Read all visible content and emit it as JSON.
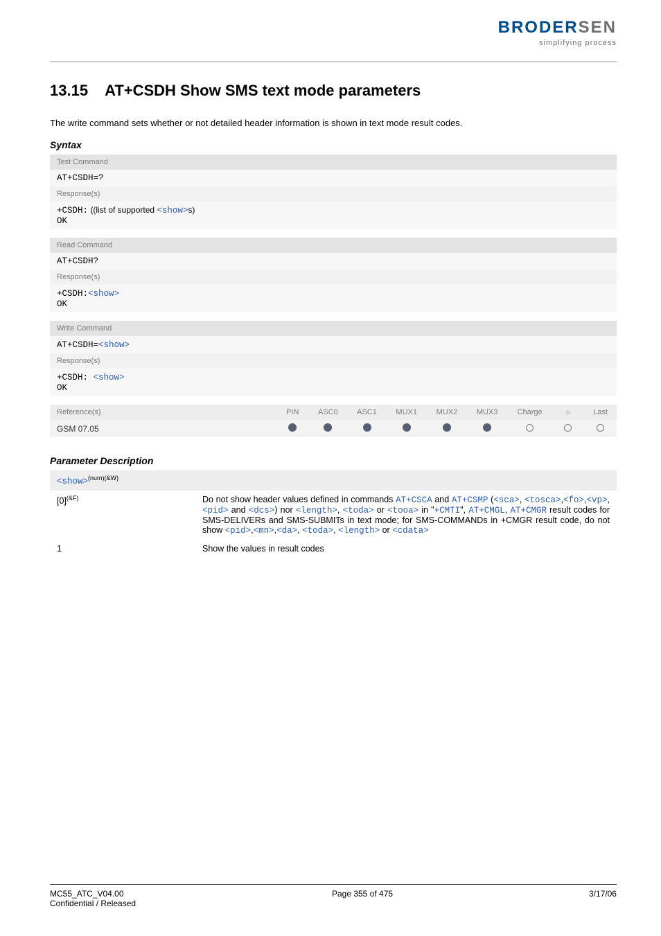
{
  "logo": {
    "brand_a": "BRODER",
    "brand_b": "SEN",
    "tagline": "simplifying process"
  },
  "section": {
    "num": "13.15",
    "title": "AT+CSDH   Show SMS text mode parameters"
  },
  "intro": "The write command sets whether or not detailed header information is shown in text mode result codes.",
  "syntax_label": "Syntax",
  "tbl": {
    "test_label": "Test Command",
    "test_cmd": "AT+CSDH=?",
    "resp_label": "Response(s)",
    "test_resp_pre": "+CSDH:",
    "test_resp_mid": " ((list of supported ",
    "test_resp_show": "<show>",
    "test_resp_post": "s)",
    "ok": "OK",
    "read_label": "Read Command",
    "read_cmd": "AT+CSDH?",
    "read_resp_pre": "+CSDH:",
    "read_resp_show": "<show>",
    "write_label": "Write Command",
    "write_cmd_pre": "AT+CSDH=",
    "write_cmd_show": "<show>",
    "write_resp_pre": "+CSDH: ",
    "write_resp_show": "<show>",
    "ref_label": "Reference(s)",
    "cols": {
      "pin": "PIN",
      "asc0": "ASC0",
      "asc1": "ASC1",
      "mux1": "MUX1",
      "mux2": "MUX2",
      "mux3": "MUX3",
      "charge": "Charge",
      "sun": "",
      "last": "Last"
    },
    "refbody": "GSM 07.05"
  },
  "paramdesc_label": "Parameter Description",
  "param": {
    "name": "<show>",
    "sup": "(num)(&W)",
    "row0_key": "[0]",
    "row0_sup": "(&F)",
    "row0_a": "Do not show header values defined in commands ",
    "row0_atcsca": "AT+CSCA",
    "row0_and": " and ",
    "row0_atcsmp": "AT+CSMP",
    "row0_b1": "(",
    "row0_sca": "<sca>",
    "row0_c1": ", ",
    "row0_tosca": "<tosca>",
    "row0_c2": ",",
    "row0_fo": "<fo>",
    "row0_c3": ",",
    "row0_vp": "<vp>",
    "row0_c4": ", ",
    "row0_pid": "<pid>",
    "row0_c5": " and ",
    "row0_dcs": "<dcs>",
    "row0_c6": ") nor ",
    "row0_length": "<length>",
    "row0_c7": ", ",
    "row0_toda": "<toda>",
    "row0_c8": " or ",
    "row0_tooa": "<tooa>",
    "row0_c9": " in \"",
    "row0_cmti": "+CMTI",
    "row0_c10": "\", ",
    "row0_atcmgl": "AT+CMGL",
    "row0_c11": ", ",
    "row0_atcmgr": "AT+CMGR",
    "row0_c12": " result codes for SMS-DELIVERs and SMS-SUBMITs in text mode; for SMS-COMMANDs in +CMGR result code, do not show ",
    "row0_pid2": "<pid>",
    "row0_c13": ",",
    "row0_mn": "<mn>",
    "row0_c14": ",",
    "row0_da": "<da>",
    "row0_c15": ", ",
    "row0_toda2": "<toda>",
    "row0_c16": ", ",
    "row0_length2": "<length>",
    "row0_c17": " or ",
    "row0_cdata": "<cdata>",
    "row1_key": "1",
    "row1_val": "Show the values in result codes"
  },
  "footer": {
    "left1": "MC55_ATC_V04.00",
    "left2": "Confidential / Released",
    "center": "Page 355 of 475",
    "right": "3/17/06"
  }
}
